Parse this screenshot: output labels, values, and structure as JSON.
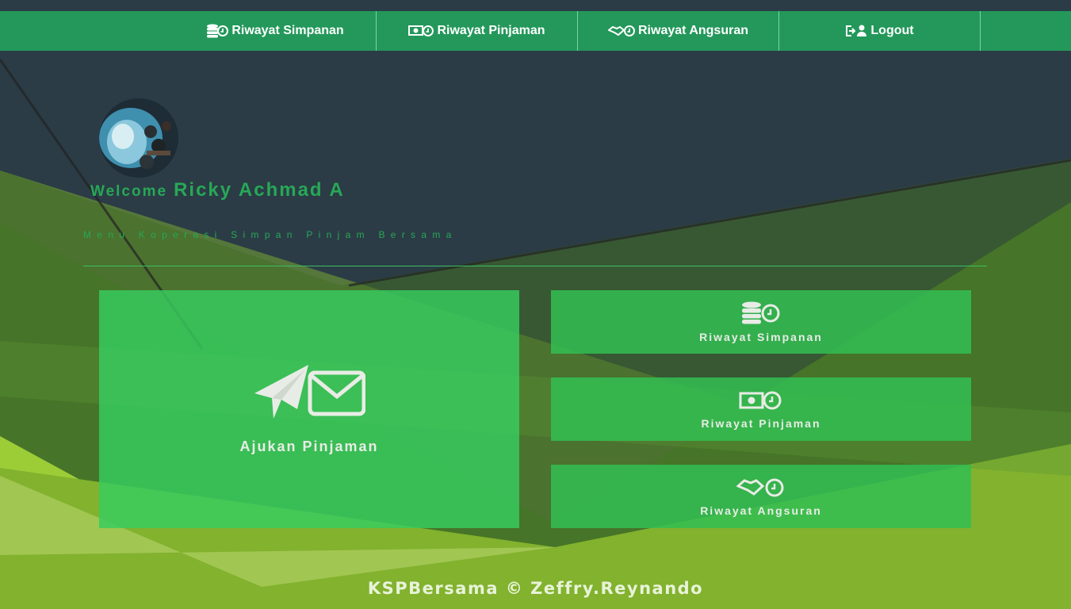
{
  "nav": {
    "items": [
      {
        "label": "Riwayat Simpanan",
        "icon": "coins-history-icon"
      },
      {
        "label": "Riwayat Pinjaman",
        "icon": "money-history-icon"
      },
      {
        "label": "Riwayat Angsuran",
        "icon": "handshake-history-icon"
      },
      {
        "label": "Logout",
        "icon": "logout-user-icon"
      }
    ]
  },
  "profile": {
    "welcome_prefix": "Welcome",
    "user_name": "Ricky Achmad A",
    "subtitle": "Menu Koperasi Simpan Pinjam Bersama"
  },
  "tiles": {
    "apply_loan": {
      "label": "Ajukan Pinjaman",
      "icon": "paper-plane-envelope-icon"
    },
    "savings_history": {
      "label": "Riwayat Simpanan",
      "icon": "coins-history-icon"
    },
    "loan_history": {
      "label": "Riwayat Pinjaman",
      "icon": "money-history-icon"
    },
    "installment_history": {
      "label": "Riwayat Angsuran",
      "icon": "handshake-history-icon"
    }
  },
  "footer": {
    "text": "KSPBersama © Zeffry.Reynando"
  },
  "colors": {
    "navbar": "#23985a",
    "background": "#2b3c46",
    "accent_green": "#27a856",
    "tile_green": "#37cd5f"
  }
}
